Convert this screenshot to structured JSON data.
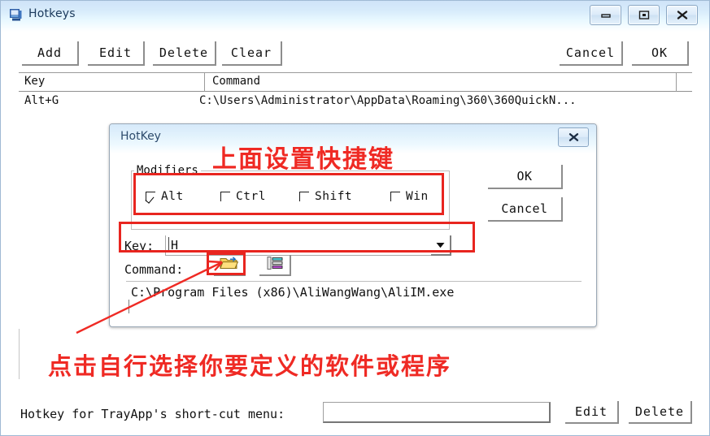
{
  "window": {
    "title": "Hotkeys",
    "icon": "window-app-icon",
    "system_buttons": [
      {
        "name": "minimize-button",
        "glyph": "minimize"
      },
      {
        "name": "maximize-button",
        "glyph": "maximize"
      },
      {
        "name": "close-button",
        "glyph": "close"
      }
    ]
  },
  "toolbar": {
    "left_buttons": [
      {
        "label": "Add",
        "name": "add-button"
      },
      {
        "label": "Edit",
        "name": "edit-button"
      },
      {
        "label": "Delete",
        "name": "delete-button"
      },
      {
        "label": "Clear",
        "name": "clear-button"
      }
    ],
    "right_buttons": [
      {
        "label": "Cancel",
        "name": "cancel-button"
      },
      {
        "label": "OK",
        "name": "ok-button"
      }
    ]
  },
  "hotkey_list": {
    "columns": [
      "Key",
      "Command"
    ],
    "rows": [
      {
        "key": "Alt+G",
        "command": "C:\\Users\\Administrator\\AppData\\Roaming\\360\\360QuickN..."
      }
    ]
  },
  "dialog": {
    "title": "HotKey",
    "close_label": "close-icon",
    "modifiers": {
      "legend": "Modifiers",
      "checkboxes": [
        {
          "label": "Alt",
          "checked": true
        },
        {
          "label": "Ctrl",
          "checked": false
        },
        {
          "label": "Shift",
          "checked": false
        },
        {
          "label": "Win",
          "checked": false
        }
      ]
    },
    "key_row": {
      "label": "Key:",
      "value": "H",
      "dropdown_icon": "chevron-down-icon"
    },
    "command_row": {
      "label": "Command:",
      "browse_icon": "open-folder-icon",
      "list_icon": "list-items-icon",
      "value": "C:\\Program Files (x86)\\AliWangWang\\AliIM.exe"
    },
    "buttons": [
      {
        "label": "OK",
        "name": "dialog-ok-button"
      },
      {
        "label": "Cancel",
        "name": "dialog-cancel-button"
      }
    ]
  },
  "annotations": {
    "top_note": "上面设置快捷键",
    "bottom_note": "点击自行选择你要定义的软件或程序",
    "color": "#ef2a24"
  },
  "bottom_bar": {
    "label": "Hotkey for TrayApp's short-cut menu:",
    "input_value": "",
    "input_placeholder": "",
    "buttons": [
      {
        "label": "Edit",
        "name": "bottom-edit-button"
      },
      {
        "label": "Delete",
        "name": "bottom-delete-button"
      }
    ]
  }
}
